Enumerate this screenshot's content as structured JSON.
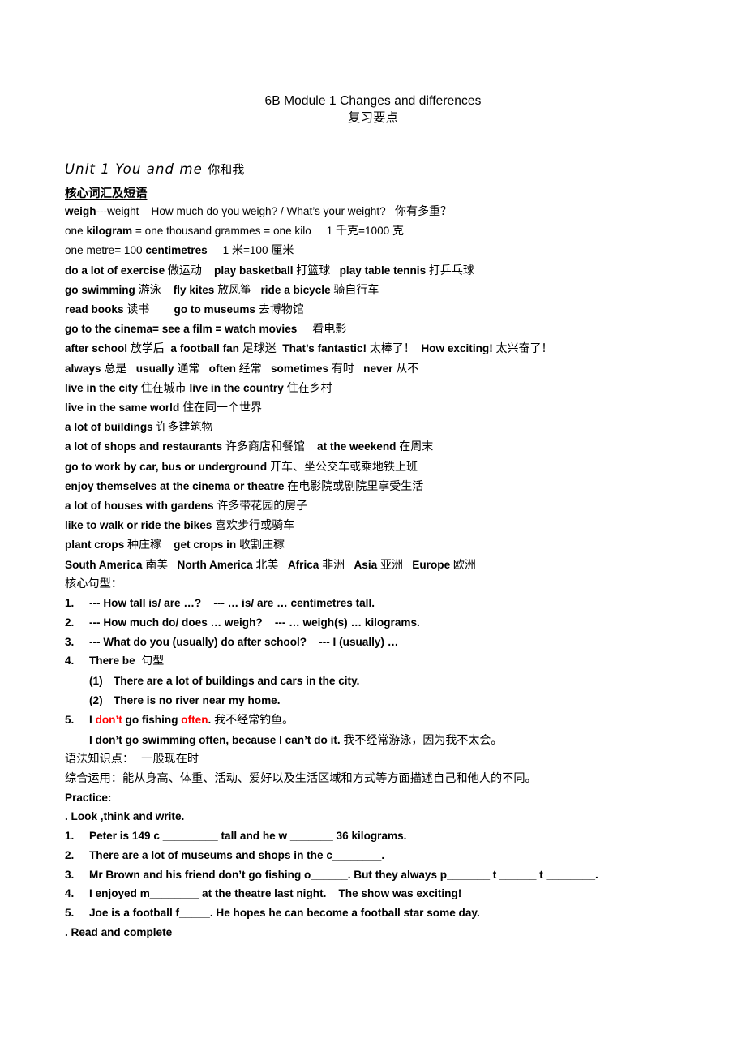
{
  "document": {
    "title": "6B Module 1 Changes and differences",
    "subtitle": "复习要点",
    "unit_heading_en": "Unit 1 You and me ",
    "unit_heading_cn": "你和我",
    "vocab_heading": "核心词汇及短语",
    "sentence_heading": "核心句型：",
    "grammar_line": "语法知识点：  一般现在时",
    "application_line": "综合运用：能从身高、体重、活动、爱好以及生活区域和方式等方面描述自己和他人的不同。",
    "practice_label": "Practice:",
    "task_a": ". Look ,think and write.",
    "task_b": ". Read and complete"
  },
  "vocab_lines": [
    {
      "id": "weigh",
      "bold_all": false,
      "parts": [
        {
          "t": "weigh",
          "style": "bold"
        },
        {
          "t": "---weight    How much do you weigh? / What’s your weight?   ",
          "style": "normal"
        },
        {
          "t": "你有多重？",
          "style": "cn"
        }
      ]
    },
    {
      "id": "kilogram",
      "bold_all": false,
      "parts": [
        {
          "t": "one ",
          "style": "normal"
        },
        {
          "t": "kilogram",
          "style": "bold"
        },
        {
          "t": " = one thousand grammes = one kilo     1 ",
          "style": "normal"
        },
        {
          "t": "千克",
          "style": "cn"
        },
        {
          "t": "=1000 ",
          "style": "normal"
        },
        {
          "t": "克",
          "style": "cn"
        }
      ]
    },
    {
      "id": "metre",
      "bold_all": false,
      "parts": [
        {
          "t": "one metre= 100 ",
          "style": "normal"
        },
        {
          "t": "centimetres",
          "style": "bold"
        },
        {
          "t": "     1 ",
          "style": "normal"
        },
        {
          "t": "米",
          "style": "cn"
        },
        {
          "t": "=100 ",
          "style": "normal"
        },
        {
          "t": "厘米",
          "style": "cn"
        }
      ]
    },
    {
      "id": "exercise",
      "bold_all": true,
      "parts": [
        {
          "t": "do a lot of exercise ",
          "style": "normal"
        },
        {
          "t": "做运动",
          "style": "cn"
        },
        {
          "t": "    play basketball ",
          "style": "normal"
        },
        {
          "t": "打篮球",
          "style": "cn"
        },
        {
          "t": "   play table tennis ",
          "style": "normal"
        },
        {
          "t": "打乒乓球",
          "style": "cn"
        }
      ]
    },
    {
      "id": "swimming",
      "bold_all": true,
      "parts": [
        {
          "t": "go swimming ",
          "style": "normal"
        },
        {
          "t": "游泳",
          "style": "cn"
        },
        {
          "t": "    fly kites ",
          "style": "normal"
        },
        {
          "t": "放风筝",
          "style": "cn"
        },
        {
          "t": "   ride a bicycle ",
          "style": "normal"
        },
        {
          "t": "骑自行车",
          "style": "cn"
        }
      ]
    },
    {
      "id": "read-books",
      "bold_all": true,
      "parts": [
        {
          "t": "read books ",
          "style": "normal"
        },
        {
          "t": "读书",
          "style": "cn"
        },
        {
          "t": "        go to museums ",
          "style": "normal"
        },
        {
          "t": "去博物馆",
          "style": "cn"
        }
      ]
    },
    {
      "id": "cinema",
      "bold_all": true,
      "parts": [
        {
          "t": "go to the cinema= see a film = watch movies     ",
          "style": "normal"
        },
        {
          "t": "看电影",
          "style": "cn"
        }
      ]
    },
    {
      "id": "after-school",
      "bold_all": true,
      "parts": [
        {
          "t": "after school ",
          "style": "normal"
        },
        {
          "t": "放学后",
          "style": "cn"
        },
        {
          "t": "  a football fan ",
          "style": "normal"
        },
        {
          "t": "足球迷",
          "style": "cn"
        },
        {
          "t": "  That’s fantastic! ",
          "style": "normal"
        },
        {
          "t": "太棒了！",
          "style": "cn"
        },
        {
          "t": "  How exciting! ",
          "style": "normal"
        },
        {
          "t": "太兴奋了！",
          "style": "cn"
        }
      ]
    },
    {
      "id": "frequency",
      "bold_all": true,
      "parts": [
        {
          "t": "always ",
          "style": "normal"
        },
        {
          "t": "总是",
          "style": "cn"
        },
        {
          "t": "   usually ",
          "style": "normal"
        },
        {
          "t": "通常",
          "style": "cn"
        },
        {
          "t": "   often ",
          "style": "normal"
        },
        {
          "t": "经常",
          "style": "cn"
        },
        {
          "t": "   sometimes ",
          "style": "normal"
        },
        {
          "t": "有时",
          "style": "cn"
        },
        {
          "t": "   never ",
          "style": "normal"
        },
        {
          "t": "从不",
          "style": "cn"
        }
      ]
    },
    {
      "id": "live-city-country",
      "bold_all": true,
      "parts": [
        {
          "t": "live in the city ",
          "style": "normal"
        },
        {
          "t": "住在城市",
          "style": "cn"
        },
        {
          "t": " live in the country ",
          "style": "normal"
        },
        {
          "t": "住在乡村",
          "style": "cn"
        }
      ]
    },
    {
      "id": "same-world",
      "bold_all": true,
      "parts": [
        {
          "t": "live in the same world ",
          "style": "normal"
        },
        {
          "t": "住在同一个世界",
          "style": "cn"
        }
      ]
    },
    {
      "id": "buildings",
      "bold_all": true,
      "parts": [
        {
          "t": "a lot of buildings ",
          "style": "normal"
        },
        {
          "t": "许多建筑物",
          "style": "cn"
        }
      ]
    },
    {
      "id": "shops-restaurants",
      "bold_all": true,
      "parts": [
        {
          "t": "a lot of shops and restaurants ",
          "style": "normal"
        },
        {
          "t": "许多商店和餐馆",
          "style": "cn"
        },
        {
          "t": "    at the weekend ",
          "style": "normal"
        },
        {
          "t": "在周末",
          "style": "cn"
        }
      ]
    },
    {
      "id": "go-to-work",
      "bold_all": true,
      "parts": [
        {
          "t": "go to work by car, bus or underground ",
          "style": "normal"
        },
        {
          "t": "开车、坐公交车或乘地铁上班",
          "style": "cn"
        }
      ]
    },
    {
      "id": "enjoy-themselves",
      "bold_all": true,
      "parts": [
        {
          "t": "enjoy themselves at the cinema or theatre ",
          "style": "normal"
        },
        {
          "t": "在电影院或剧院里享受生活",
          "style": "cn"
        }
      ]
    },
    {
      "id": "houses-gardens",
      "bold_all": true,
      "parts": [
        {
          "t": "a lot of houses with gardens ",
          "style": "normal"
        },
        {
          "t": "许多带花园的房子",
          "style": "cn"
        }
      ]
    },
    {
      "id": "walk-ride",
      "bold_all": true,
      "parts": [
        {
          "t": "like to walk or ride the bikes ",
          "style": "normal"
        },
        {
          "t": "喜欢步行或骑车",
          "style": "cn"
        }
      ]
    },
    {
      "id": "crops",
      "bold_all": true,
      "parts": [
        {
          "t": "plant crops ",
          "style": "normal"
        },
        {
          "t": "种庄稼",
          "style": "cn"
        },
        {
          "t": "    get crops in ",
          "style": "normal"
        },
        {
          "t": "收割庄稼",
          "style": "cn"
        }
      ]
    },
    {
      "id": "continents",
      "bold_all": true,
      "parts": [
        {
          "t": "South America ",
          "style": "normal"
        },
        {
          "t": "南美",
          "style": "cn"
        },
        {
          "t": "   North America ",
          "style": "normal"
        },
        {
          "t": "北美",
          "style": "cn"
        },
        {
          "t": "   Africa ",
          "style": "normal"
        },
        {
          "t": "非洲",
          "style": "cn"
        },
        {
          "t": "   Asia ",
          "style": "normal"
        },
        {
          "t": "亚洲",
          "style": "cn"
        },
        {
          "t": "   Europe ",
          "style": "normal"
        },
        {
          "t": "欧洲",
          "style": "cn"
        }
      ]
    }
  ],
  "sentence_patterns": [
    {
      "marker": "1.",
      "kind": "num",
      "parts": [
        {
          "t": "--- How tall is/ are …?    --- … is/ are … centimetres tall.",
          "style": "normal"
        }
      ]
    },
    {
      "marker": "2.",
      "kind": "num",
      "parts": [
        {
          "t": "--- How much do/ does … weigh?    --- … weigh(s) … kilograms.",
          "style": "normal"
        }
      ]
    },
    {
      "marker": "3.",
      "kind": "num",
      "parts": [
        {
          "t": "--- What do you (usually) do after school?    --- I (usually) …",
          "style": "normal"
        }
      ]
    },
    {
      "marker": "4.",
      "kind": "num",
      "parts": [
        {
          "t": "There be  ",
          "style": "normal"
        },
        {
          "t": "句型",
          "style": "cn"
        }
      ]
    },
    {
      "marker": "(1)",
      "kind": "sub",
      "parts": [
        {
          "t": "There are a lot of buildings and cars in the city.",
          "style": "normal"
        }
      ]
    },
    {
      "marker": "(2)",
      "kind": "sub",
      "parts": [
        {
          "t": "There is no river near my home.",
          "style": "normal"
        }
      ]
    },
    {
      "marker": "5.",
      "kind": "num",
      "parts": [
        {
          "t": "I ",
          "style": "normal"
        },
        {
          "t": "don’t",
          "style": "red"
        },
        {
          "t": " go fishing ",
          "style": "normal"
        },
        {
          "t": "often",
          "style": "red"
        },
        {
          "t": ". ",
          "style": "normal"
        },
        {
          "t": "我不经常钓鱼。",
          "style": "cn"
        }
      ]
    },
    {
      "marker": "",
      "kind": "cont",
      "parts": [
        {
          "t": "I don’t go swimming often, because I can’t do it. ",
          "style": "normal"
        },
        {
          "t": "我不经常游泳，因为我不太会。",
          "style": "cn"
        }
      ]
    }
  ],
  "practice_items": [
    {
      "marker": "1.",
      "parts": [
        {
          "t": "Peter is 149 c _________ tall and he w _______ 36 kilograms.",
          "style": "normal"
        }
      ]
    },
    {
      "marker": "2.",
      "parts": [
        {
          "t": "There are a lot of museums and shops in the c________.",
          "style": "normal"
        }
      ]
    },
    {
      "marker": "3.",
      "parts": [
        {
          "t": "Mr Brown and his friend don’t go fishing o______. But they always p_______ t ______ t ________.",
          "style": "normal"
        }
      ]
    },
    {
      "marker": "4.",
      "parts": [
        {
          "t": "I enjoyed m________ at the theatre last night.    The show was exciting!",
          "style": "normal"
        }
      ]
    },
    {
      "marker": "5.",
      "parts": [
        {
          "t": "Joe is a football f_____. He hopes he can become a football star some day.",
          "style": "normal"
        }
      ]
    }
  ],
  "colors": {
    "text": "#000000",
    "highlight_red": "#FF0000",
    "background": "#FFFFFF"
  }
}
